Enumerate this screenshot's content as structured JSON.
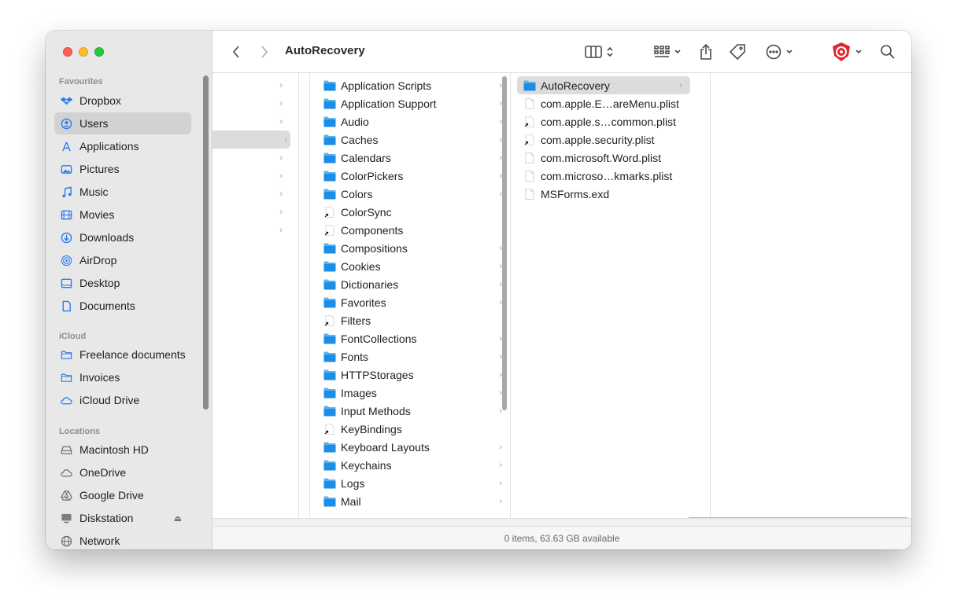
{
  "window": {
    "title": "AutoRecovery"
  },
  "sidebar": {
    "favourites_heading": "Favourites",
    "favourites": [
      {
        "label": "Dropbox",
        "icon": "dropbox-icon"
      },
      {
        "label": "Users",
        "icon": "user-circle-icon",
        "selected": true
      },
      {
        "label": "Applications",
        "icon": "applications-icon"
      },
      {
        "label": "Pictures",
        "icon": "pictures-icon"
      },
      {
        "label": "Music",
        "icon": "music-icon"
      },
      {
        "label": "Movies",
        "icon": "movies-icon"
      },
      {
        "label": "Downloads",
        "icon": "downloads-icon"
      },
      {
        "label": "AirDrop",
        "icon": "airdrop-icon"
      },
      {
        "label": "Desktop",
        "icon": "desktop-icon"
      },
      {
        "label": "Documents",
        "icon": "documents-icon"
      }
    ],
    "icloud_heading": "iCloud",
    "icloud": [
      {
        "label": "Freelance documents",
        "icon": "folder-icon"
      },
      {
        "label": "Invoices",
        "icon": "folder-icon"
      },
      {
        "label": "iCloud Drive",
        "icon": "cloud-icon"
      }
    ],
    "locations_heading": "Locations",
    "locations": [
      {
        "label": "Macintosh HD",
        "icon": "disk-icon"
      },
      {
        "label": "OneDrive",
        "icon": "cloud-icon"
      },
      {
        "label": "Google Drive",
        "icon": "google-drive-icon"
      },
      {
        "label": "Diskstation",
        "icon": "display-icon",
        "eject": "⏏"
      },
      {
        "label": "Network",
        "icon": "network-icon"
      }
    ]
  },
  "column2": [
    {
      "name": "Application Scripts",
      "type": "folder"
    },
    {
      "name": "Application Support",
      "type": "folder"
    },
    {
      "name": "Audio",
      "type": "folder"
    },
    {
      "name": "Caches",
      "type": "folder"
    },
    {
      "name": "Calendars",
      "type": "folder"
    },
    {
      "name": "ColorPickers",
      "type": "folder"
    },
    {
      "name": "Colors",
      "type": "folder"
    },
    {
      "name": "ColorSync",
      "type": "alias"
    },
    {
      "name": "Components",
      "type": "alias"
    },
    {
      "name": "Compositions",
      "type": "folder"
    },
    {
      "name": "Cookies",
      "type": "folder"
    },
    {
      "name": "Dictionaries",
      "type": "folder"
    },
    {
      "name": "Favorites",
      "type": "folder"
    },
    {
      "name": "Filters",
      "type": "alias"
    },
    {
      "name": "FontCollections",
      "type": "folder"
    },
    {
      "name": "Fonts",
      "type": "folder"
    },
    {
      "name": "HTTPStorages",
      "type": "folder"
    },
    {
      "name": "Images",
      "type": "folder"
    },
    {
      "name": "Input Methods",
      "type": "folder"
    },
    {
      "name": "KeyBindings",
      "type": "alias"
    },
    {
      "name": "Keyboard Layouts",
      "type": "folder"
    },
    {
      "name": "Keychains",
      "type": "folder"
    },
    {
      "name": "Logs",
      "type": "folder"
    },
    {
      "name": "Mail",
      "type": "folder"
    }
  ],
  "column3": [
    {
      "name": "AutoRecovery",
      "type": "folder",
      "selected": true
    },
    {
      "name": "com.apple.E…areMenu.plist",
      "type": "file"
    },
    {
      "name": "com.apple.s…common.plist",
      "type": "alias"
    },
    {
      "name": "com.apple.security.plist",
      "type": "alias"
    },
    {
      "name": "com.microsoft.Word.plist",
      "type": "file"
    },
    {
      "name": "com.microso…kmarks.plist",
      "type": "file"
    },
    {
      "name": "MSForms.exd",
      "type": "file"
    }
  ],
  "status": {
    "text": "0 items, 63.63 GB available"
  },
  "colors": {
    "accent": "#2a7cf0",
    "folder": "#5ab3ef",
    "selection": "#dcdcdc"
  }
}
